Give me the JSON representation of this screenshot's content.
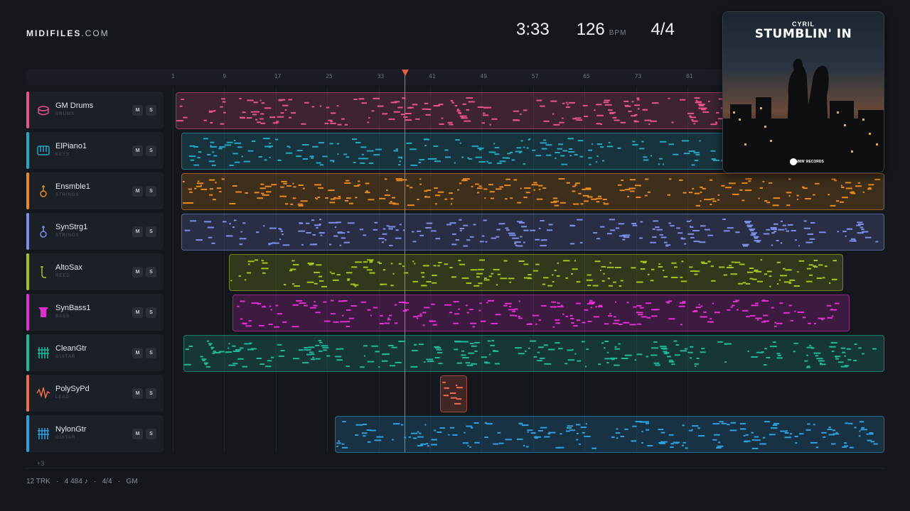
{
  "logo": {
    "brand": "MIDIFILES",
    "domain": ".COM"
  },
  "header": {
    "duration": "3:33",
    "tempo": "126",
    "tempo_unit": "BPM",
    "time_signature": "4/4"
  },
  "ruler": {
    "bars": [
      "1",
      "9",
      "17",
      "25",
      "33",
      "41",
      "49",
      "57",
      "65",
      "73",
      "81"
    ]
  },
  "playhead": {
    "bar": 37
  },
  "tracks": [
    {
      "name": "GM Drums",
      "category": "DRUMS",
      "color": "#e8538a",
      "icon": "drum-icon",
      "mute": "M",
      "solo": "S"
    },
    {
      "name": "ElPiano1",
      "category": "KEYS",
      "color": "#26a7c4",
      "icon": "piano-icon",
      "mute": "M",
      "solo": "S"
    },
    {
      "name": "Ensmble1",
      "category": "STRINGS",
      "color": "#e88a1f",
      "icon": "violin-icon",
      "mute": "M",
      "solo": "S"
    },
    {
      "name": "SynStrg1",
      "category": "STRINGS",
      "color": "#7c8ee8",
      "icon": "violin-icon",
      "mute": "M",
      "solo": "S"
    },
    {
      "name": "AltoSax",
      "category": "REED",
      "color": "#a3c41f",
      "icon": "sax-icon",
      "mute": "M",
      "solo": "S"
    },
    {
      "name": "SynBass1",
      "category": "BASS",
      "color": "#e22fd0",
      "icon": "bass-amp-icon",
      "mute": "M",
      "solo": "S"
    },
    {
      "name": "CleanGtr",
      "category": "GUITAR",
      "color": "#1fb89b",
      "icon": "guitar-fretboard-icon",
      "mute": "M",
      "solo": "S"
    },
    {
      "name": "PolySyPd",
      "category": "LEAD",
      "color": "#f06a4e",
      "icon": "waveform-icon",
      "mute": "M",
      "solo": "S"
    },
    {
      "name": "NylonGtr",
      "category": "GUITAR",
      "color": "#2f9fe0",
      "icon": "guitar-fretboard-icon",
      "mute": "M",
      "solo": "S"
    }
  ],
  "more_tracks": "+3",
  "footer": {
    "tracks": "12 TRK",
    "notes": "4 484 ♪",
    "meter": "4/4",
    "standard": "GM",
    "separator": "·"
  },
  "cover": {
    "artist": "CYRIL",
    "title": "STUMBLIN' IN",
    "label": "SPINNIN' RECORDS"
  }
}
